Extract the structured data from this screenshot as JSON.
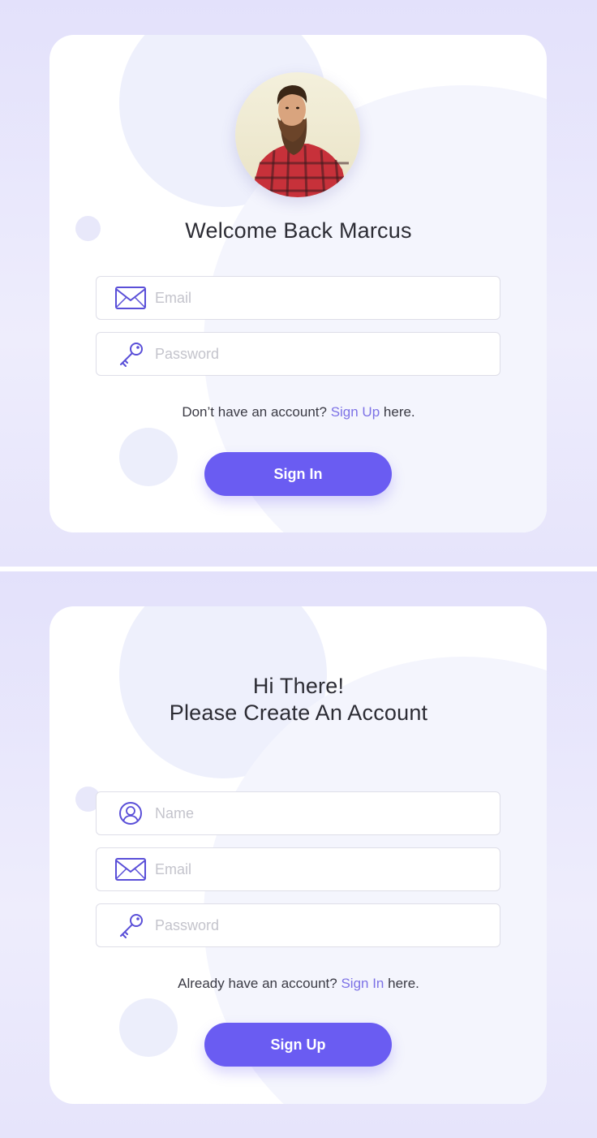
{
  "login": {
    "title": "Welcome Back Marcus",
    "email_placeholder": "Email",
    "password_placeholder": "Password",
    "helper_prefix": "Don’t have an account?",
    "helper_link": "Sign Up",
    "helper_suffix": "here.",
    "button_label": "Sign In"
  },
  "signup": {
    "title_line1": "Hi There!",
    "title_line2": "Please Create An Account",
    "name_placeholder": "Name",
    "email_placeholder": "Email",
    "password_placeholder": "Password",
    "helper_prefix": "Already have an account?",
    "helper_link": "Sign In",
    "helper_suffix": "here.",
    "button_label": "Sign Up"
  },
  "icons": {
    "email": "envelope-icon",
    "password": "key-icon",
    "name": "user-icon"
  },
  "colors": {
    "accent": "#6a5cf2",
    "link": "#7d72e6",
    "icon_stroke": "#5a4fd8",
    "background": "#e3e1fb"
  }
}
